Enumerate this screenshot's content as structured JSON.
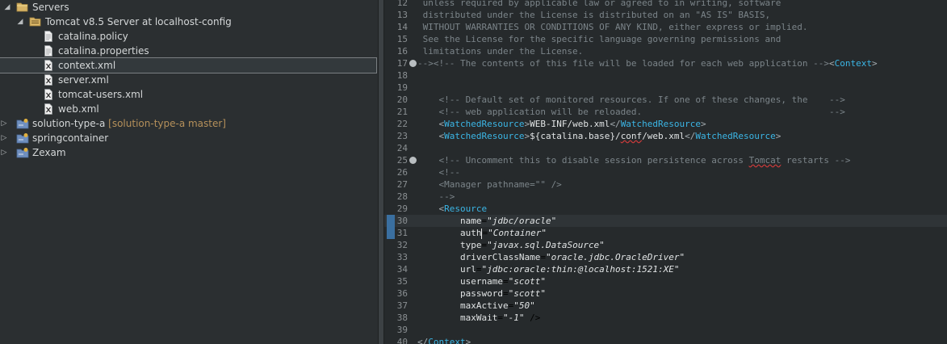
{
  "explorer": {
    "servers_label": "Servers",
    "tomcat_label": "Tomcat v8.5 Server at localhost-config",
    "files": [
      "catalina.policy",
      "catalina.properties",
      "context.xml",
      "server.xml",
      "tomcat-users.xml",
      "web.xml"
    ],
    "selected_file": "context.xml",
    "projects": [
      {
        "name": "solution-type-a",
        "repo": "[solution-type-a master]"
      },
      {
        "name": "springcontainer",
        "repo": ""
      },
      {
        "name": "Zexam",
        "repo": ""
      }
    ]
  },
  "editor": {
    "current_line": 30,
    "lines": [
      {
        "n": "12",
        "t": " unless required by applicable law or agreed to in writing, software"
      },
      {
        "n": "13",
        "t": " distributed under the License is distributed on an \"AS IS\" BASIS,"
      },
      {
        "n": "14",
        "t": " WITHOUT WARRANTIES OR CONDITIONS OF ANY KIND, either express or implied."
      },
      {
        "n": "15",
        "t": " See the License for the specific language governing permissions and"
      },
      {
        "n": "16",
        "t": " limitations under the License."
      },
      {
        "n": "17",
        "t": "--><!-- The contents of this file will be loaded for each web application --><Context>"
      },
      {
        "n": "18",
        "t": ""
      },
      {
        "n": "19",
        "t": ""
      },
      {
        "n": "20",
        "t": "    <!-- Default set of monitored resources. If one of these changes, the    -->"
      },
      {
        "n": "21",
        "t": "    <!-- web application will be reloaded.                                   -->"
      },
      {
        "n": "22",
        "t": "    <WatchedResource>WEB-INF/web.xml</WatchedResource>"
      },
      {
        "n": "23",
        "t": "    <WatchedResource>${catalina.base}/conf/web.xml</WatchedResource>"
      },
      {
        "n": "24",
        "t": ""
      },
      {
        "n": "25",
        "t": "    <!-- Uncomment this to disable session persistence across Tomcat restarts -->"
      },
      {
        "n": "26",
        "t": "    <!--"
      },
      {
        "n": "27",
        "t": "    <Manager pathname=\"\" />"
      },
      {
        "n": "28",
        "t": "    -->"
      },
      {
        "n": "29",
        "t": "    <Resource"
      },
      {
        "n": "30",
        "t": "        name=\"jdbc/oracle\""
      },
      {
        "n": "31",
        "t": "        auth=\"Container\""
      },
      {
        "n": "32",
        "t": "        type=\"javax.sql.DataSource\""
      },
      {
        "n": "33",
        "t": "        driverClassName=\"oracle.jdbc.OracleDriver\""
      },
      {
        "n": "34",
        "t": "        url=\"jdbc:oracle:thin:@localhost:1521:XE\""
      },
      {
        "n": "35",
        "t": "        username=\"scott\""
      },
      {
        "n": "36",
        "t": "        password=\"scott\""
      },
      {
        "n": "37",
        "t": "        maxActive=\"50\""
      },
      {
        "n": "38",
        "t": "        maxWait=\"-1\" />"
      },
      {
        "n": "39",
        "t": ""
      },
      {
        "n": "40",
        "t": "</Context>"
      }
    ]
  }
}
